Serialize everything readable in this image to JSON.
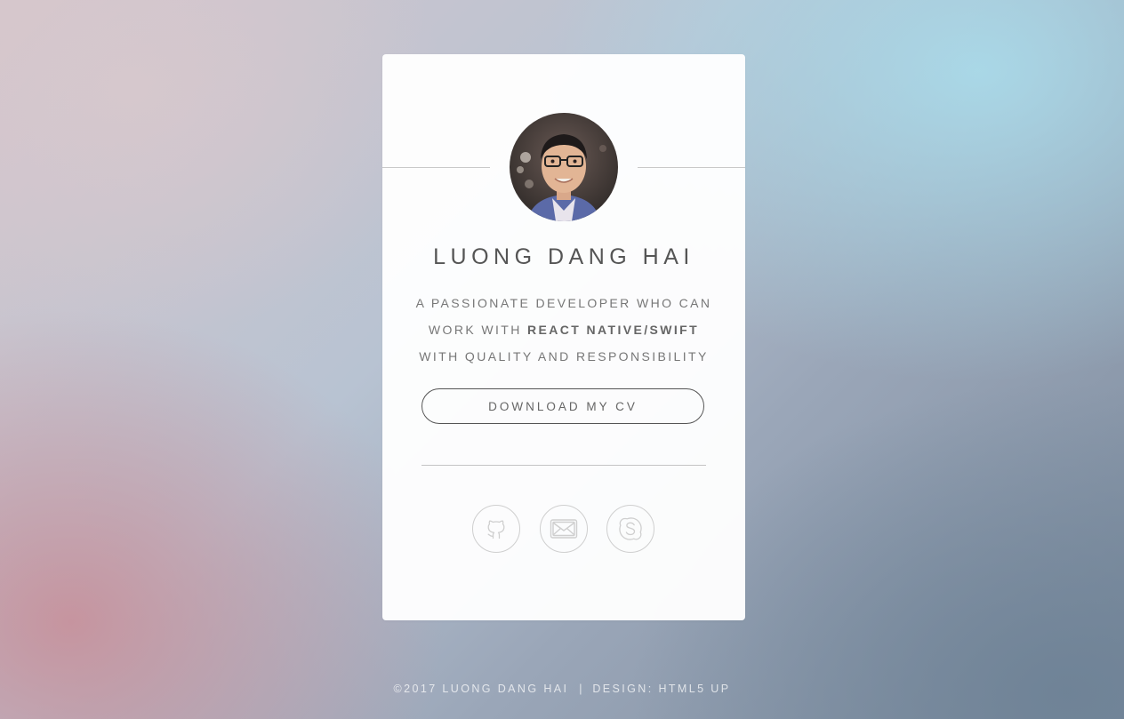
{
  "profile": {
    "name": "LUONG DANG HAI",
    "tagline_line1": "A PASSIONATE DEVELOPER WHO CAN",
    "tagline_line2_prefix": "WORK WITH ",
    "tagline_line2_strong": "REACT NATIVE/SWIFT",
    "tagline_line3": "WITH QUALITY AND RESPONSIBILITY"
  },
  "actions": {
    "download_cv_label": "DOWNLOAD MY CV"
  },
  "social": [
    {
      "icon": "github-icon"
    },
    {
      "icon": "mail-icon"
    },
    {
      "icon": "skype-icon"
    }
  ],
  "footer": {
    "copyright": "©2017 LUONG DANG HAI",
    "separator": "|",
    "design": "DESIGN: HTML5 UP"
  },
  "colors": {
    "card_bg": "#fafafa",
    "text": "#666666",
    "icon_stroke": "#cfcfcf"
  }
}
